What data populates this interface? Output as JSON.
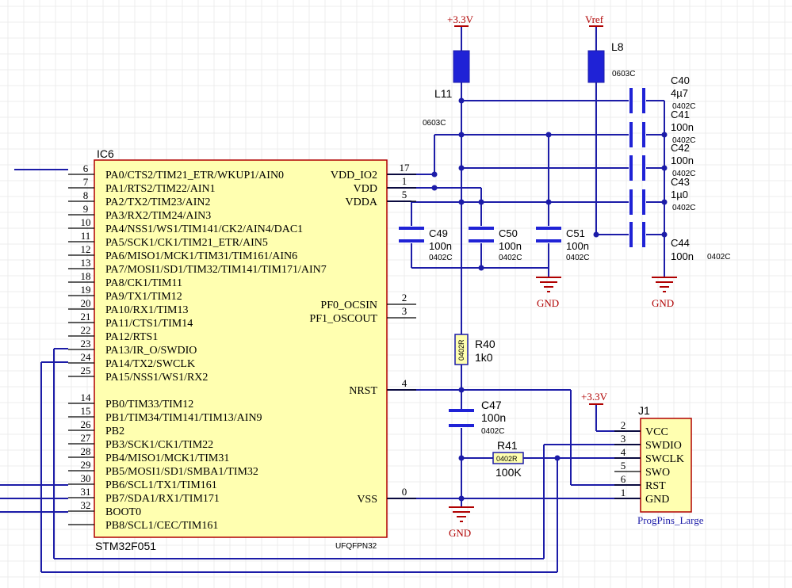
{
  "ic": {
    "designator": "IC6",
    "part": "STM32F051",
    "package": "UFQFPN32",
    "left_pins": [
      {
        "num": "6",
        "name": "PA0/CTS2/TIM21_ETR/WKUP1/AIN0"
      },
      {
        "num": "7",
        "name": "PA1/RTS2/TIM22/AIN1"
      },
      {
        "num": "8",
        "name": "PA2/TX2/TIM23/AIN2"
      },
      {
        "num": "9",
        "name": "PA3/RX2/TIM24/AIN3"
      },
      {
        "num": "10",
        "name": "PA4/NSS1/WS1/TIM141/CK2/AIN4/DAC1"
      },
      {
        "num": "11",
        "name": "PA5/SCK1/CK1/TIM21_ETR/AIN5"
      },
      {
        "num": "12",
        "name": "PA6/MISO1/MCK1/TIM31/TIM161/AIN6"
      },
      {
        "num": "13",
        "name": "PA7/MOSI1/SD1/TIM32/TIM141/TIM171/AIN7"
      },
      {
        "num": "18",
        "name": "PA8/CK1/TIM11"
      },
      {
        "num": "19",
        "name": "PA9/TX1/TIM12"
      },
      {
        "num": "20",
        "name": "PA10/RX1/TIM13"
      },
      {
        "num": "21",
        "name": "PA11/CTS1/TIM14"
      },
      {
        "num": "22",
        "name": "PA12/RTS1"
      },
      {
        "num": "23",
        "name": "PA13/IR_O/SWDIO"
      },
      {
        "num": "24",
        "name": "PA14/TX2/SWCLK"
      },
      {
        "num": "25",
        "name": "PA15/NSS1/WS1/RX2"
      },
      {
        "num": "14",
        "name": "PB0/TIM33/TIM12"
      },
      {
        "num": "15",
        "name": "PB1/TIM34/TIM141/TIM13/AIN9"
      },
      {
        "num": "26",
        "name": "PB2"
      },
      {
        "num": "27",
        "name": "PB3/SCK1/CK1/TIM22"
      },
      {
        "num": "28",
        "name": "PB4/MISO1/MCK1/TIM31"
      },
      {
        "num": "29",
        "name": "PB5/MOSI1/SD1/SMBA1/TIM32"
      },
      {
        "num": "30",
        "name": "PB6/SCL1/TX1/TIM161"
      },
      {
        "num": "31",
        "name": "PB7/SDA1/RX1/TIM171"
      },
      {
        "num": "32",
        "name": "BOOT0"
      },
      {
        "num": "",
        "name": "PB8/SCL1/CEC/TIM161"
      }
    ],
    "right_pins": [
      {
        "num": "17",
        "name": "VDD_IO2"
      },
      {
        "num": "1",
        "name": "VDD"
      },
      {
        "num": "5",
        "name": "VDDA"
      },
      {
        "num": "2",
        "name": "PF0_OCSIN"
      },
      {
        "num": "3",
        "name": "PF1_OSCOUT"
      },
      {
        "num": "4",
        "name": "NRST"
      },
      {
        "num": "0",
        "name": "VSS"
      }
    ]
  },
  "power": {
    "v33_top": "+3.3V",
    "vref": "Vref",
    "v33_j1": "+3.3V",
    "gnd_labels": [
      "GND",
      "GND",
      "GND"
    ]
  },
  "inductors": [
    {
      "ref": "L11",
      "pkg": "0603C"
    },
    {
      "ref": "L8",
      "pkg": "0603C"
    }
  ],
  "caps_right": [
    {
      "ref": "C40",
      "value": "4µ7",
      "pkg": "0402C"
    },
    {
      "ref": "C41",
      "value": "100n",
      "pkg": "0402C"
    },
    {
      "ref": "C42",
      "value": "100n",
      "pkg": "0402C"
    },
    {
      "ref": "C43",
      "value": "1µ0",
      "pkg": "0402C"
    },
    {
      "ref": "C44",
      "value": "100n",
      "pkg": "0402C"
    }
  ],
  "caps_mid": [
    {
      "ref": "C49",
      "value": "100n",
      "pkg": "0402C"
    },
    {
      "ref": "C50",
      "value": "100n",
      "pkg": "0402C"
    },
    {
      "ref": "C51",
      "value": "100n",
      "pkg": "0402C"
    }
  ],
  "r40": {
    "ref": "R40",
    "value": "1k0",
    "pkg": "0402R"
  },
  "c47": {
    "ref": "C47",
    "value": "100n",
    "pkg": "0402C"
  },
  "r41": {
    "ref": "R41",
    "value": "100K",
    "pkg": "0402R"
  },
  "j1": {
    "ref": "J1",
    "part": "ProgPins_Large",
    "pins": [
      {
        "num": "2",
        "name": "VCC"
      },
      {
        "num": "3",
        "name": "SWDIO"
      },
      {
        "num": "4",
        "name": "SWCLK"
      },
      {
        "num": "5",
        "name": "SWO"
      },
      {
        "num": "6",
        "name": "RST"
      },
      {
        "num": "1",
        "name": "GND"
      }
    ]
  },
  "colors": {
    "wire": "#1c1ca8",
    "component": "#1f22d6",
    "ic_fill": "#ffffb0",
    "ic_border": "#b00000",
    "power": "#b00000",
    "grid": "#ececec"
  }
}
